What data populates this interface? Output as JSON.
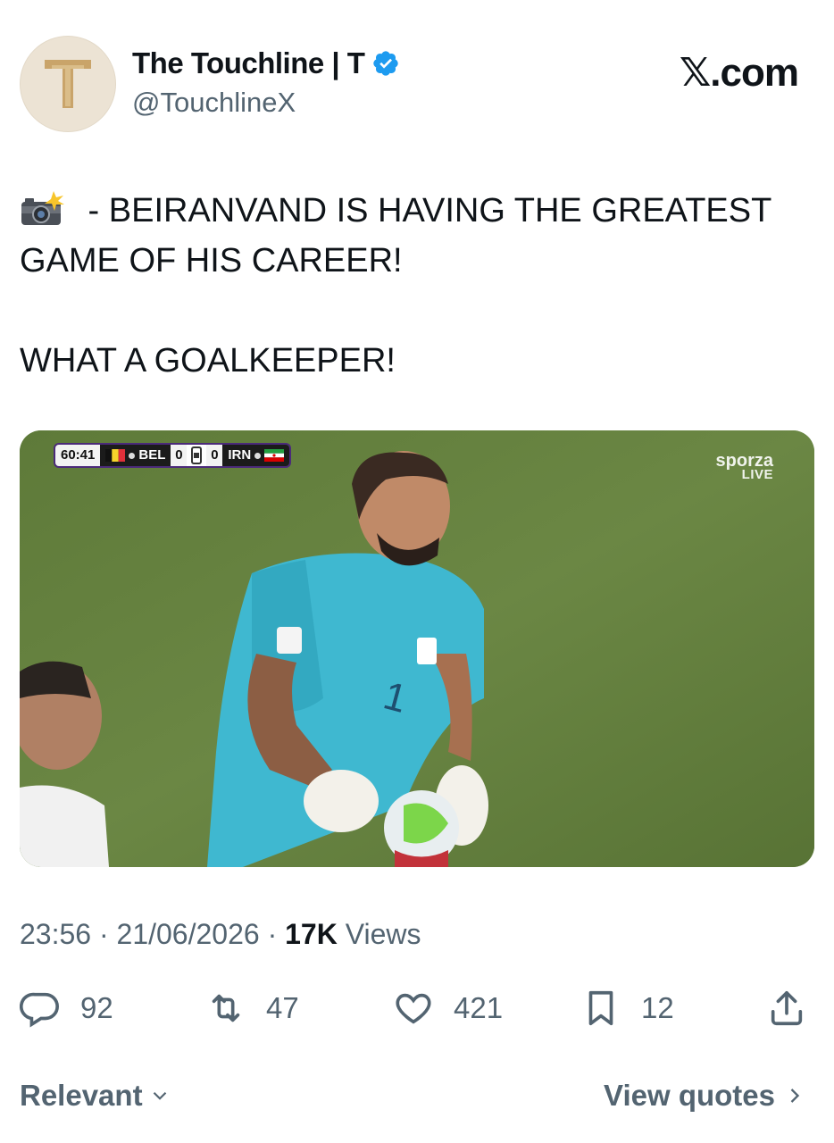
{
  "author": {
    "display_name": "The Touchline | T",
    "handle": "@TouchlineX",
    "verified": true,
    "avatar_icon": "touchline-t-logo-icon"
  },
  "brand": "𝕏.com",
  "tweet": {
    "line1": " - BEIRANVAND IS HAVING THE GREATEST GAME OF HIS CAREER!",
    "line2": "WHAT A GOALKEEPER!",
    "emoji": "camera-flash-icon"
  },
  "media": {
    "scorebug": {
      "clock": "60:41",
      "home_team": "BEL",
      "home_score": "0",
      "away_score": "0",
      "away_team": "IRN"
    },
    "broadcaster": "sporza",
    "broadcaster_sub": "LIVE"
  },
  "meta": {
    "time": "23:56",
    "date": "21/06/2026",
    "views_count": "17K",
    "views_label": "Views"
  },
  "actions": {
    "replies": "92",
    "reposts": "47",
    "likes": "421",
    "bookmarks": "12"
  },
  "footer": {
    "sort_label": "Relevant",
    "quotes_label": "View quotes"
  },
  "colors": {
    "verified": "#1d9bf0",
    "secondary_text": "#536471",
    "primary_text": "#0f1419"
  }
}
